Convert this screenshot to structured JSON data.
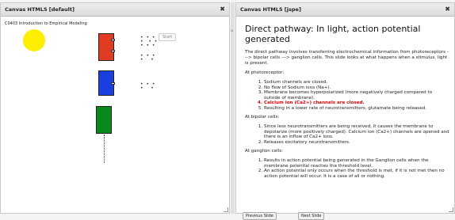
{
  "left_panel": {
    "title": "Canvas HTML5 [default]",
    "close": "✖",
    "course": "C0403 Introduction to Empirical Modeling",
    "start": "Start"
  },
  "right_panel": {
    "title": "Canvas HTML5 [jspe]",
    "close": "✖"
  },
  "splitter_label": "u",
  "slide": {
    "heading": "Direct pathway: In light, action potential generated",
    "intro": "The direct pathway involves transferring electrochemical information from photoreceptors ---> bipolar cells ---> ganglion cells. This slide looks at what happens when a stimulus, light is present.",
    "photoreceptor_label": "At photoreceptor:",
    "photoreceptor_items": [
      "Sodium channels are closed.",
      "No flow of Sodium ions (Na+).",
      "Membrane becomes hyperpolarized (more negatively charged compared to outside of membrane).",
      "Calcium ion (Ca2+) channels are closed.",
      "Resulting in a lower rate of neurotransmitters, glutamate being released."
    ],
    "bipolar_label": "At bipolar cells:",
    "bipolar_items": [
      "Since less neurotransmitters are being received, it causes the membrane to depolarize (more positively charged). Calcium ion (Ca2+) channels are opened and there is an inflow of Ca2+ ions.",
      "Releases excitatory neurotransmitters."
    ],
    "ganglion_label": "At ganglion cells:",
    "ganglion_items": [
      "Results in action potential being generated in the Ganglion cells when the membrane potential reaches the threshold level.",
      "An action potential only occurs when the threshold is met, if it is not met then no action potential will occur. It is a case of all or nothing."
    ]
  },
  "nav": {
    "previous": "Previous Slide",
    "next": "Next Slide"
  },
  "molecules": {
    "cluster1": "• • •\n•  • •\n• • •",
    "cluster2": "• • •\n•   •",
    "cluster3": "• • •\n•   •"
  },
  "colors": {
    "photoreceptor": "#e23b23",
    "bipolar": "#1a3fe0",
    "ganglion": "#0a8a1e",
    "stimulus": "#ffee00",
    "highlight": "#e00000"
  }
}
